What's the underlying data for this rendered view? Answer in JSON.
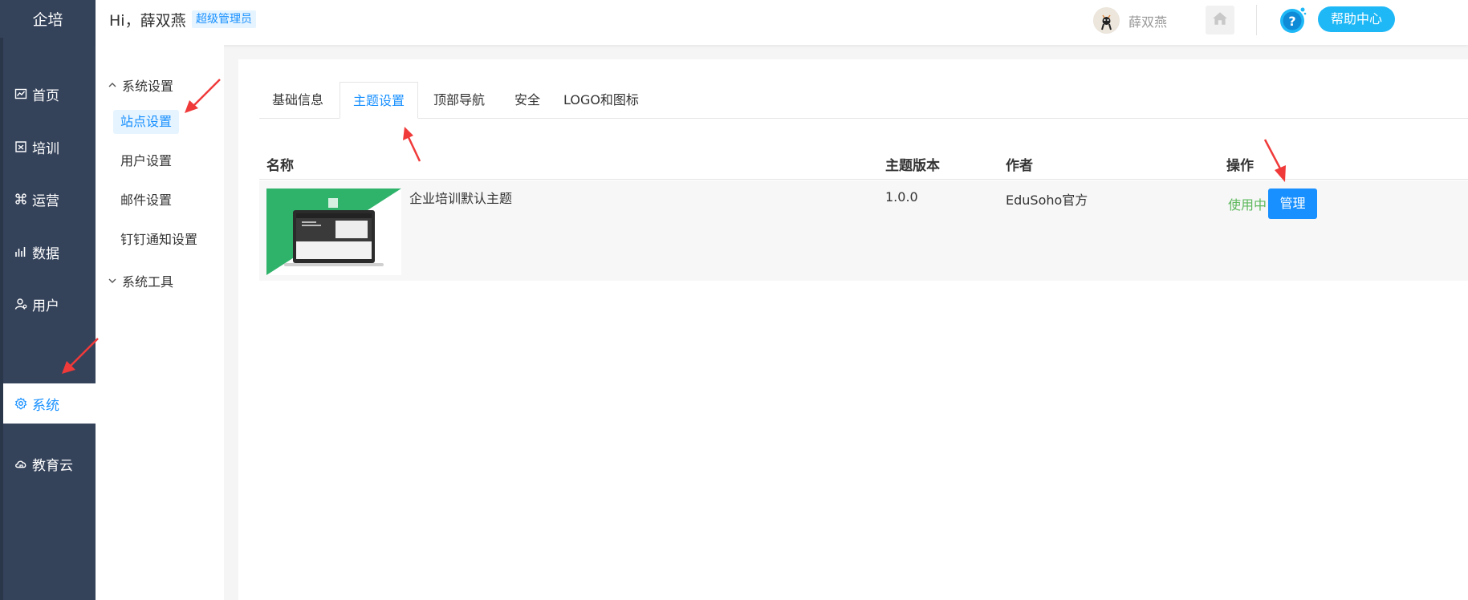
{
  "brand": "企培",
  "header": {
    "greeting": "Hi，薛双燕",
    "role_badge": "超级管理员",
    "user_name": "薛双燕",
    "help_button": "帮助中心"
  },
  "sidebar": {
    "items": [
      {
        "label": "首页",
        "icon": "chart-icon"
      },
      {
        "label": "培训",
        "icon": "train-icon"
      },
      {
        "label": "运营",
        "icon": "command-icon"
      },
      {
        "label": "数据",
        "icon": "data-icon"
      },
      {
        "label": "用户",
        "icon": "user-icon"
      },
      {
        "label": "系统",
        "icon": "gear-icon",
        "active": true
      },
      {
        "label": "教育云",
        "icon": "cloud-icon"
      }
    ]
  },
  "submenu": {
    "group_system_settings": "系统设置",
    "items": [
      "站点设置",
      "用户设置",
      "邮件设置",
      "钉钉通知设置"
    ],
    "group_system_tools": "系统工具"
  },
  "tabs": [
    "基础信息",
    "主题设置",
    "顶部导航",
    "安全",
    "LOGO和图标"
  ],
  "table": {
    "headers": {
      "name": "名称",
      "version": "主题版本",
      "author": "作者",
      "action": "操作"
    },
    "rows": [
      {
        "name": "企业培训默认主题",
        "version": "1.0.0",
        "author": "EduSoho官方",
        "status": "使用中",
        "action_button": "管理"
      }
    ]
  },
  "colors": {
    "sidebar_bg": "#34425a",
    "accent": "#1890ff",
    "status_green": "#5cb85c",
    "help_bg": "#1fb8f6",
    "arrow_red": "#f03a3a"
  }
}
